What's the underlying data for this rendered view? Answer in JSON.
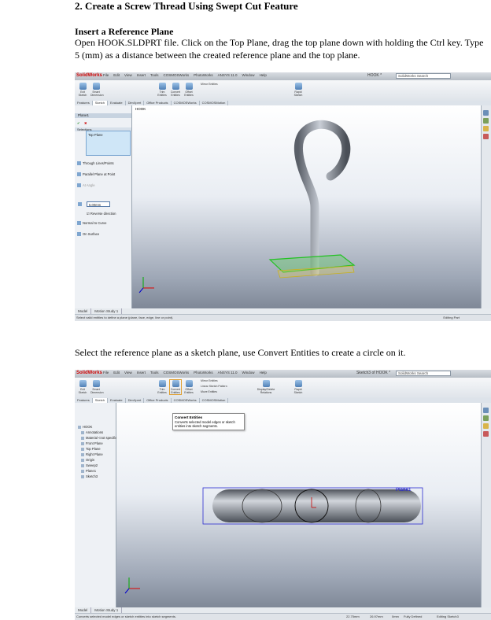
{
  "heading": "2. Create a Screw Thread Using Swept Cut Feature",
  "subheading": "Insert a Reference Plane",
  "paragraph1": "Open HOOK.SLDPRT file. Click on the Top Plane, drag the top plane down with holding the Ctrl key. Type 5 (mm) as a distance between the created reference plane and the top plane.",
  "paragraph2": "Select the reference plane as a sketch plane, use Convert Entities to create a circle on it.",
  "screenshot1": {
    "app_name": "SolidWorks",
    "menus": [
      "File",
      "Edit",
      "View",
      "Insert",
      "Tools",
      "COSMOSWorks",
      "PhotoWorks",
      "ANSYS 11.0",
      "Window",
      "Help"
    ],
    "doc_name": "HOOK *",
    "search_placeholder": "SolidWorks Search",
    "ribbon_buttons": [
      "Exit Sketch",
      "Smart Dimension",
      "Trim Entities",
      "Convert Entities",
      "Offset Entities",
      "Mirror Entities",
      "Rapid Sketch"
    ],
    "tabs": [
      "Features",
      "Sketch",
      "Evaluate",
      "DimXpert",
      "Office Products",
      "COSMOSWorks",
      "COSMOSMotion"
    ],
    "tree_root": "HOOK",
    "panel_title": "Plane1",
    "panel_section": "Selections",
    "selection_value": "Top Plane",
    "options": [
      "Through Lines/Points",
      "Parallel Plane at Point",
      "At Angle",
      "Normal to Curve",
      "On Surface"
    ],
    "distance_value": "5.00mm",
    "reverse_direction": "Reverse direction",
    "bottom_tabs": [
      "Model",
      "Motion Study 1"
    ],
    "status_left": "Select valid entities to define a plane (plane, face, edge, line or point).",
    "status_right": "Editing Part"
  },
  "screenshot2": {
    "app_name": "SolidWorks",
    "menus": [
      "File",
      "Edit",
      "View",
      "Insert",
      "Tools",
      "COSMOSWorks",
      "PhotoWorks",
      "ANSYS 11.0",
      "Window",
      "Help"
    ],
    "doc_name": "Sketch3 of HOOK *",
    "search_placeholder": "SolidWorks Search",
    "ribbon_buttons": [
      "Exit Sketch",
      "Smart Dimension",
      "Trim Entities",
      "Convert Entities",
      "Offset Entities",
      "Mirror Entities",
      "Linear Sketch Pattern",
      "Move Entities",
      "Display/Delete Relations",
      "Rapid Sketch"
    ],
    "tabs": [
      "Features",
      "Sketch",
      "Evaluate",
      "DimXpert",
      "Office Products",
      "COSMOSWorks",
      "COSMOSMotion"
    ],
    "tree": [
      "HOOK",
      "Annotations",
      "Material <not specified>",
      "Front Plane",
      "Top Plane",
      "Right Plane",
      "Origin",
      "Sweep2",
      "Plane1",
      "Sketch3"
    ],
    "tooltip_title": "Convert Entities",
    "tooltip_text": "Converts selected model edges or sketch entities into sketch segments.",
    "plane_label": "Plane1",
    "bottom_tabs": [
      "Model",
      "Motion Study 1"
    ],
    "status_left": "Converts selected model edges or sketch entities into sketch segments.",
    "status_items": [
      "22.75mm",
      "26.97mm",
      "0mm",
      "Fully Defined",
      "Editing Sketch3"
    ]
  },
  "colors": {
    "accent": "#4f7fb5",
    "sketch_blue": "#2b2bd0",
    "plane_green": "#22c122"
  }
}
